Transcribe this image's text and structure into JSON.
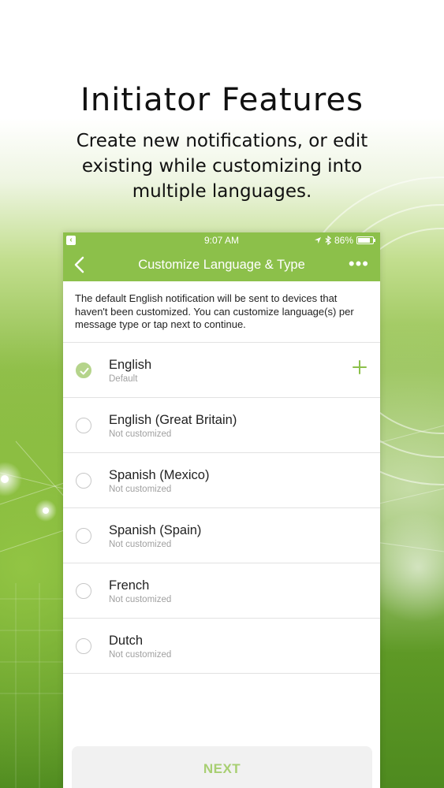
{
  "promo": {
    "headline": "Initiator Features",
    "subline": "Create new notifications, or edit existing while customizing into multiple languages."
  },
  "statusbar": {
    "time": "9:07 AM",
    "battery": "86%",
    "battery_level": 0.86
  },
  "navbar": {
    "title": "Customize Language & Type",
    "back_icon": "chevron-left-icon",
    "more_icon": "ellipsis-icon"
  },
  "intro_text": "The default English notification will be sent to devices that haven't been customized. You can customize language(s) per message type or tap next to continue.",
  "languages": [
    {
      "name": "English",
      "status": "Default",
      "selected": true
    },
    {
      "name": "English (Great Britain)",
      "status": "Not customized",
      "selected": false
    },
    {
      "name": "Spanish (Mexico)",
      "status": "Not customized",
      "selected": false
    },
    {
      "name": "Spanish (Spain)",
      "status": "Not customized",
      "selected": false
    },
    {
      "name": "French",
      "status": "Not customized",
      "selected": false
    },
    {
      "name": "Dutch",
      "status": "Not customized",
      "selected": false
    }
  ],
  "next_label": "NEXT",
  "colors": {
    "brand_green": "#8cc04a",
    "check_green": "#b5d48b",
    "next_text": "#a8cf72"
  }
}
